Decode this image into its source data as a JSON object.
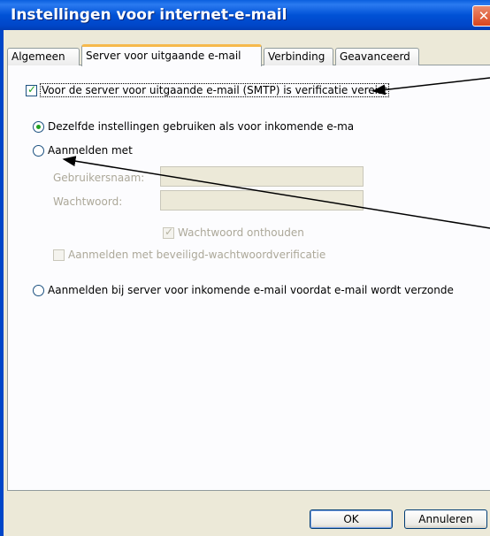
{
  "dialog": {
    "title": "Instellingen voor internet-e-mail",
    "close_symbol": "✕"
  },
  "tabs": [
    {
      "label": "Algemeen",
      "active": false
    },
    {
      "label": "Server voor uitgaande e-mail",
      "active": true
    },
    {
      "label": "Verbinding",
      "active": false
    },
    {
      "label": "Geavanceerd",
      "active": false
    }
  ],
  "smtp_auth": {
    "checked": true,
    "label": "Voor de server voor uitgaande e-mail (SMTP) is verificatie vereist"
  },
  "radio_same_settings": {
    "selected": true,
    "label": "Dezelfde instellingen gebruiken als voor inkomende e-ma"
  },
  "radio_login_with": {
    "selected": false,
    "label": "Aanmelden met"
  },
  "username": {
    "label": "Gebruikersnaam:",
    "value": ""
  },
  "password": {
    "label": "Wachtwoord:",
    "value": ""
  },
  "remember_password": {
    "checked": true,
    "label": "Wachtwoord onthouden"
  },
  "spa": {
    "checked": false,
    "label": "Aanmelden met beveiligd-wachtwoordverificatie"
  },
  "radio_login_incoming": {
    "selected": false,
    "label": "Aanmelden bij server voor inkomende e-mail voordat e-mail wordt verzonde"
  },
  "buttons": {
    "ok": "OK",
    "cancel": "Annuleren"
  },
  "colors": {
    "title_bar": "#0054e3",
    "arrow": "#000000",
    "check": "#21a121"
  }
}
